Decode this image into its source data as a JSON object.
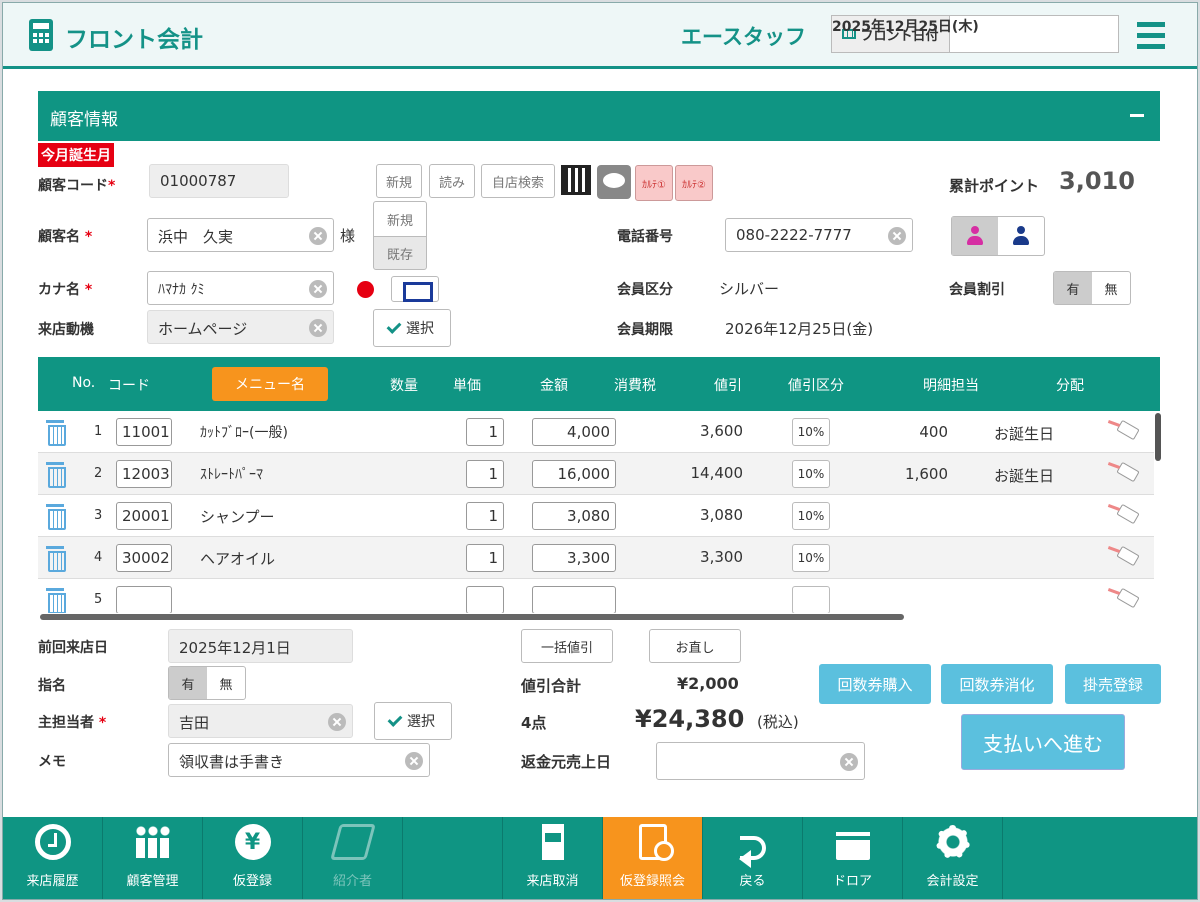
{
  "header": {
    "title": "フロント会計",
    "staff": "エースタッフ",
    "front_date_label": "フロント日付",
    "front_date": "2025年12月25日(木)"
  },
  "customer": {
    "panel_title": "顧客情報",
    "birthday_badge": "今月誕生月",
    "code_label": "顧客コード",
    "code": "01000787",
    "btn_new": "新規",
    "btn_read": "読み",
    "btn_store_search": "自店検索",
    "karte1": "ｶﾙﾃ①",
    "karte2": "ｶﾙﾃ②",
    "points_label": "累計ポイント",
    "points": "3,010",
    "name_label": "顧客名",
    "name": "浜中　久実",
    "honorific": "様",
    "popup_new": "新規",
    "popup_existing": "既存",
    "phone_label": "電話番号",
    "phone": "080-2222-7777",
    "kana_label": "カナ名",
    "kana": "ﾊﾏﾅｶ ｸﾐ",
    "member_type_label": "会員区分",
    "member_type": "シルバー",
    "member_discount_label": "会員割引",
    "yes": "有",
    "no": "無",
    "visit_reason_label": "来店動機",
    "visit_reason": "ホームページ",
    "select_btn": "選択",
    "member_expiry_label": "会員期限",
    "member_expiry": "2026年12月25日(金)"
  },
  "table": {
    "headers": {
      "no": "No.",
      "code": "コード",
      "menu": "メニュー名",
      "qty": "数量",
      "unit_price": "単価",
      "amount": "金額",
      "tax": "消費税",
      "discount": "値引",
      "discount_type": "値引区分",
      "staff": "明細担当",
      "split": "分配"
    },
    "rows": [
      {
        "no": "1",
        "code": "11001",
        "menu": "ｶｯﾄﾌﾞﾛｰ(一般)",
        "qty": "1",
        "amount": "4,000",
        "discount": "3,600",
        "discount_type": "10%",
        "staff_val": "400",
        "split": "お誕生日"
      },
      {
        "no": "2",
        "code": "12003",
        "menu": "ｽﾄﾚｰﾄﾊﾟｰﾏ",
        "qty": "1",
        "amount": "16,000",
        "discount": "14,400",
        "discount_type": "10%",
        "staff_val": "1,600",
        "split": "お誕生日"
      },
      {
        "no": "3",
        "code": "20001",
        "menu": "シャンプー",
        "qty": "1",
        "amount": "3,080",
        "discount": "3,080",
        "discount_type": "10%",
        "staff_val": "",
        "split": ""
      },
      {
        "no": "4",
        "code": "30002",
        "menu": "ヘアオイル",
        "qty": "1",
        "amount": "3,300",
        "discount": "3,300",
        "discount_type": "10%",
        "staff_val": "",
        "split": ""
      },
      {
        "no": "5",
        "code": "",
        "menu": "",
        "qty": "",
        "amount": "",
        "discount": "",
        "discount_type": "",
        "staff_val": "",
        "split": ""
      }
    ]
  },
  "summary": {
    "last_visit_label": "前回来店日",
    "last_visit": "2025年12月1日",
    "nominated_label": "指名",
    "main_staff_label": "主担当者",
    "main_staff": "吉田",
    "memo_label": "メモ",
    "memo": "領収書は手書き",
    "bulk_discount": "一括値引",
    "redo": "お直し",
    "discount_total_label": "値引合計",
    "discount_total": "¥2,000",
    "item_count": "4点",
    "total": "¥24,380",
    "tax_incl": "(税込)",
    "refund_label": "返金元売上日",
    "btn_ticket_buy": "回数券購入",
    "btn_ticket_use": "回数券消化",
    "btn_credit": "掛売登録",
    "btn_pay": "支払いへ進む"
  },
  "footer": [
    {
      "label": "来店履歴",
      "icon": "clock-check-icon"
    },
    {
      "label": "顧客管理",
      "icon": "people-icon"
    },
    {
      "label": "仮登録",
      "icon": "yen-icon"
    },
    {
      "label": "紹介者",
      "icon": "handshake-icon"
    },
    {
      "label": "",
      "icon": ""
    },
    {
      "label": "来店取消",
      "icon": "door-icon"
    },
    {
      "label": "仮登録照会",
      "icon": "document-search-icon"
    },
    {
      "label": "戻る",
      "icon": "back-arrow-icon"
    },
    {
      "label": "ドロア",
      "icon": "cash-drawer-icon"
    },
    {
      "label": "会計設定",
      "icon": "gear-icon"
    },
    {
      "label": "",
      "icon": ""
    }
  ],
  "colors": {
    "brand": "#149287",
    "accent": "#f7941d",
    "danger": "#e60012",
    "action": "#5bc0de"
  }
}
